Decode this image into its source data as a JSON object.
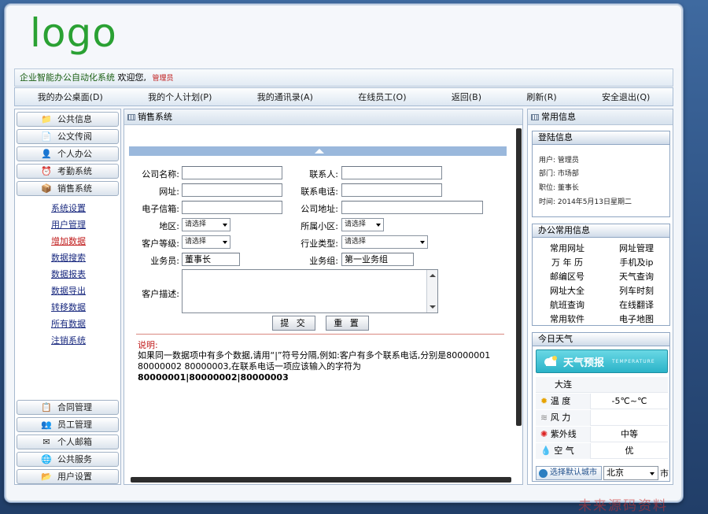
{
  "logo": "logo",
  "welcome": {
    "system": "企业智能办公自动化系统",
    "greet": "欢迎您,",
    "user": "管理员"
  },
  "nav": [
    "我的办公桌面(D)",
    "我的个人计划(P)",
    "我的通讯录(A)",
    "在线员工(O)",
    "返回(B)",
    "刷新(R)",
    "安全退出(Q)"
  ],
  "left_menu": {
    "top": [
      "公共信息",
      "公文传阅",
      "个人办公",
      "考勤系统",
      "销售系统"
    ],
    "sub": [
      "系统设置",
      "用户管理",
      "增加数据",
      "数据搜索",
      "数据报表",
      "数据导出",
      "转移数据",
      "所有数据",
      "注销系统"
    ],
    "bottom": [
      "合同管理",
      "员工管理",
      "个人邮箱",
      "公共服务",
      "用户设置"
    ]
  },
  "main": {
    "title": "销售系统",
    "labels": {
      "company": "公司名称:",
      "contact": "联系人:",
      "site": "网址:",
      "phone": "联系电话:",
      "email": "电子信箱:",
      "address": "公司地址:",
      "region": "地区:",
      "district": "所属小区:",
      "level": "客户等级:",
      "industry": "行业类型:",
      "salesman": "业务员:",
      "group": "业务组:",
      "desc": "客户描述:"
    },
    "select_placeholder": "请选择",
    "salesman_value": "董事长",
    "group_value": "第一业务组",
    "submit": "提 交",
    "reset": "重 置",
    "note_title": "说明:",
    "note_text": "如果同一数据项中有多个数据,请用“|”符号分隔,例如:客户有多个联系电话,分别是80000001 80000002 80000003,在联系电话一项应该输入的字符为 ",
    "note_example": "80000001|80000002|80000003"
  },
  "right": {
    "panel_title": "常用信息",
    "login": {
      "title": "登陆信息",
      "user": "用户:  管理员",
      "dept": "部门:  市场部",
      "position": "职位:  董事长",
      "time": "时间:  2014年5月13日星期二"
    },
    "office": {
      "title": "办公常用信息",
      "links": [
        "常用网址",
        "网址管理",
        "万 年 历",
        "手机及ip",
        "邮编区号",
        "天气查询",
        "网址大全",
        "列车时刻",
        "航班查询",
        "在线翻译",
        "常用软件",
        "电子地图"
      ]
    },
    "weather": {
      "title": "今日天气",
      "banner": "天气预报",
      "banner_en": "TEMPERATURE",
      "city": "大连",
      "rows": [
        {
          "k": "温  度",
          "v": "-5℃~℃"
        },
        {
          "k": "风  力",
          "v": ""
        },
        {
          "k": "紫外线",
          "v": "中等"
        },
        {
          "k": "空  气",
          "v": "优"
        }
      ],
      "choose_city": "选择默认城市",
      "selected_city": "北京",
      "suffix": "市"
    }
  },
  "watermark": "未来源码资料"
}
